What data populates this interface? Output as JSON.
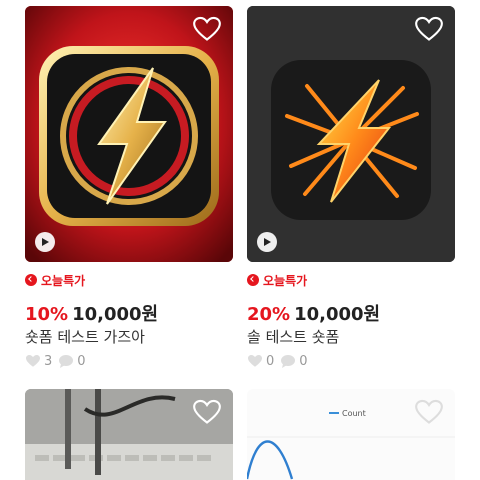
{
  "products": [
    {
      "badge": "오늘특가",
      "discount": "10%",
      "price": "10,000원",
      "title": "숏폼 테스트 가즈아",
      "likes": "3",
      "comments": "0"
    },
    {
      "badge": "오늘특가",
      "discount": "20%",
      "price": "10,000원",
      "title": "솔 테스트 숏폼",
      "likes": "0",
      "comments": "0"
    }
  ],
  "chart_preview": {
    "legend": "Count"
  },
  "icons": {
    "favorite": "heart-icon",
    "play": "play-icon",
    "deal": "tag-icon",
    "like": "like-icon",
    "comment": "comment-icon"
  },
  "colors": {
    "accent": "#e5161e",
    "text": "#222222",
    "muted": "#999999"
  }
}
